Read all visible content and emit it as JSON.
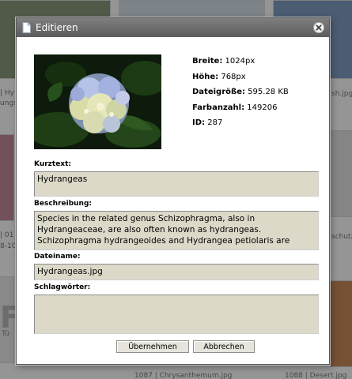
{
  "background": {
    "captions": [
      "| Hy",
      "ungs",
      "| 01",
      "8-10",
      "Tü",
      "schutz",
      "sh.jpg",
      "1087 | Chrysanthemum.jpg",
      "1088 | Desert.jpg"
    ],
    "big_letter": "F"
  },
  "dialog": {
    "title": "Editieren",
    "info": [
      {
        "key": "Breite:",
        "value": "1024px"
      },
      {
        "key": "Höhe:",
        "value": "768px"
      },
      {
        "key": "Dateigröße:",
        "value": "595.28 KB"
      },
      {
        "key": "Farbanzahl:",
        "value": "149206"
      },
      {
        "key": "ID:",
        "value": "287"
      }
    ],
    "fields": {
      "kurztext_label": "Kurztext:",
      "kurztext_value": "Hydrangeas",
      "beschreibung_label": "Beschreibung:",
      "beschreibung_value": "Species in the related genus Schizophragma, also in Hydrangeaceae, are also often known as hydrangeas. Schizophragma hydrangeoides and Hydrangea petiolaris are",
      "dateiname_label": "Dateiname:",
      "dateiname_value": "Hydrangeas.jpg",
      "schlagwoerter_label": "Schlagwörter:",
      "schlagwoerter_value": ""
    },
    "buttons": {
      "apply": "Übernehmen",
      "cancel": "Abbrechen"
    }
  }
}
